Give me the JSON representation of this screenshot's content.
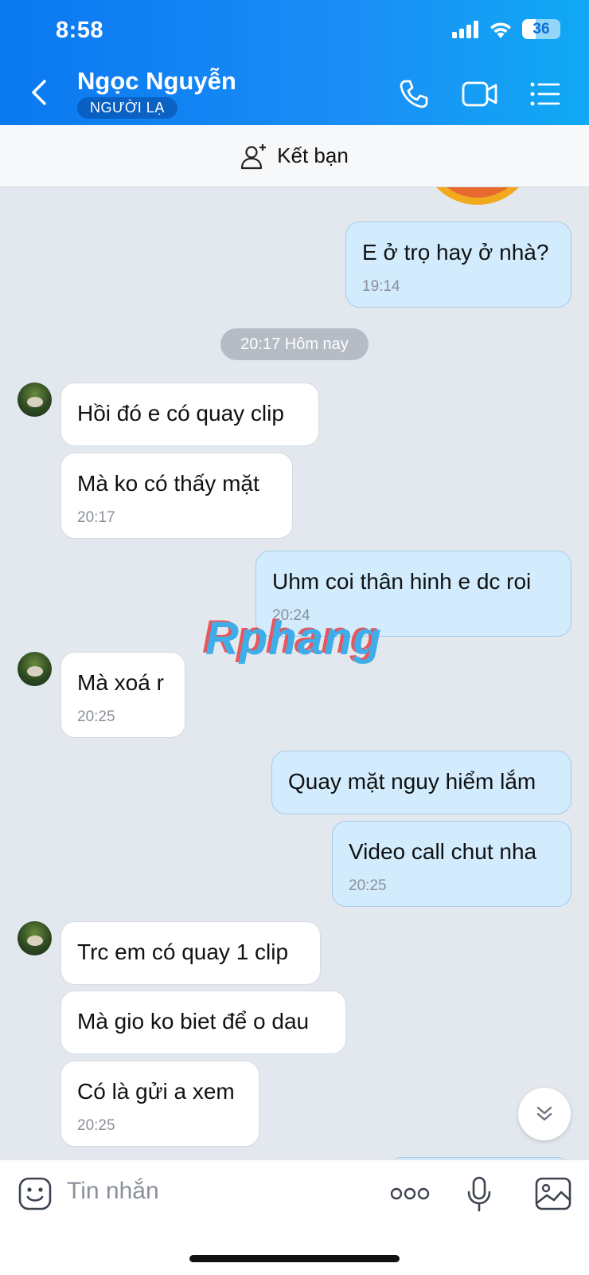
{
  "status_bar": {
    "time": "8:58",
    "battery": "36"
  },
  "header": {
    "contact_name": "Ngọc Nguyễn",
    "badge": "NGƯỜI LẠ"
  },
  "add_friend": {
    "label": "Kết bạn"
  },
  "messages": [
    {
      "direction": "out",
      "text": "E ở trọ hay ở nhà?",
      "time": "19:14"
    },
    {
      "direction": "in",
      "text": "Hồi đó e có quay clip",
      "time": ""
    },
    {
      "direction": "in",
      "text": "Mà ko có thấy mặt",
      "time": "20:17"
    },
    {
      "direction": "out",
      "text": "Uhm coi thân hinh e dc roi",
      "time": "20:24"
    },
    {
      "direction": "in",
      "text": "Mà xoá r",
      "time": "20:25"
    },
    {
      "direction": "out",
      "text": "Quay mặt nguy hiểm lắm",
      "time": ""
    },
    {
      "direction": "out",
      "text": "Video call chut nha",
      "time": "20:25"
    },
    {
      "direction": "in",
      "text": "Trc em có quay 1 clip",
      "time": ""
    },
    {
      "direction": "in",
      "text": "Mà gio ko biet để o dau",
      "time": ""
    },
    {
      "direction": "in",
      "text": "Có là gửi a xem",
      "time": "20:25"
    }
  ],
  "date_separator": "20:17 Hôm nay",
  "watermark": "Rphang",
  "composer": {
    "placeholder": "Tin nhắn"
  },
  "colors": {
    "header": "#0a78f0",
    "incoming_bubble": "#ffffff",
    "outgoing_bubble": "#d2ecfd",
    "chat_background": "#e3e8ef"
  },
  "icons": [
    "back-icon",
    "phone-icon",
    "video-call-icon",
    "menu-list-icon",
    "add-friend-icon",
    "sticker-icon",
    "more-icon",
    "microphone-icon",
    "image-icon",
    "scroll-down-icon"
  ]
}
